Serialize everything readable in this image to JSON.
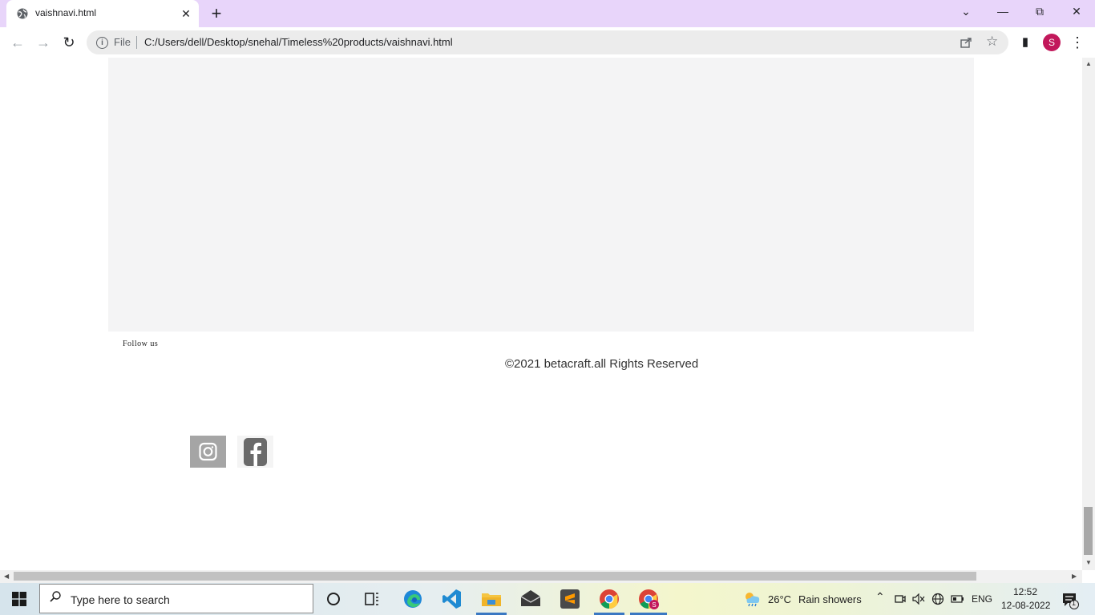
{
  "browser": {
    "tab_title": "vaishnavi.html",
    "tab_close": "✕",
    "new_tab": "+",
    "window_controls": {
      "collapse": "⌄",
      "minimize": "—",
      "restore": "⧉",
      "close": "✕"
    },
    "nav": {
      "back": "←",
      "forward": "→",
      "reload": "↻"
    },
    "omnibox": {
      "info": "i",
      "scheme_label": "File",
      "url": "C:/Users/dell/Desktop/snehal/Timeless%20products/vaishnavi.html",
      "share_icon": "share-icon",
      "bookmark_icon": "☆"
    },
    "side_panel": "▮",
    "profile_initial": "S",
    "menu": "⋮"
  },
  "page": {
    "follow_label": "Follow us",
    "copyright": "©2021 betacraft.all Rights Reserved",
    "social_icons": [
      "instagram-icon",
      "facebook-icon"
    ]
  },
  "taskbar": {
    "search_placeholder": "Type here to search",
    "apps": [
      "cortana-icon",
      "task-view-icon",
      "edge-icon",
      "vscode-icon",
      "file-explorer-icon",
      "mail-icon",
      "sublime-text-icon",
      "chrome-icon",
      "chrome-profile-icon"
    ],
    "weather": {
      "temperature": "26°C",
      "condition": "Rain showers"
    },
    "language": "ENG",
    "time": "12:52",
    "date": "12-08-2022",
    "notification_count": "1"
  },
  "colors": {
    "titlebar": "#e8d5fa",
    "page_block": "#f4f4f5",
    "avatar": "#c2185b",
    "social_bg_instagram": "#a5a5a5"
  }
}
